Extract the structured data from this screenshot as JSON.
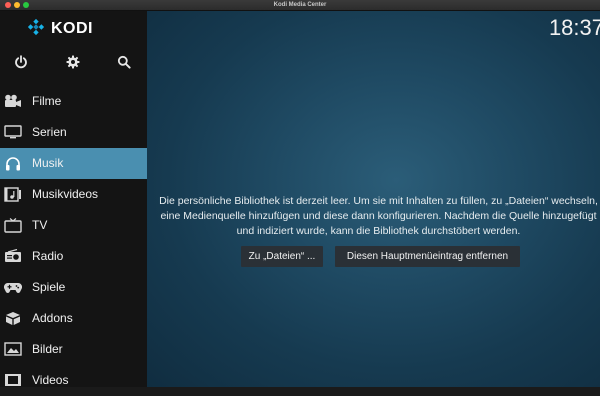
{
  "window": {
    "title": "Kodi Media Center"
  },
  "brand": {
    "name": "KODI",
    "color": "#17b2e7"
  },
  "system": {
    "icons": [
      "power-icon",
      "gear-icon",
      "search-icon"
    ]
  },
  "sidebar": {
    "active_color": "#4a8fb0",
    "items": [
      {
        "label": "Filme",
        "icon": "movie-camera-icon",
        "active": false
      },
      {
        "label": "Serien",
        "icon": "tv-screen-icon",
        "active": false
      },
      {
        "label": "Musik",
        "icon": "headphones-icon",
        "active": true
      },
      {
        "label": "Musikvideos",
        "icon": "music-video-icon",
        "active": false
      },
      {
        "label": "TV",
        "icon": "television-icon",
        "active": false
      },
      {
        "label": "Radio",
        "icon": "radio-icon",
        "active": false
      },
      {
        "label": "Spiele",
        "icon": "gamepad-icon",
        "active": false
      },
      {
        "label": "Addons",
        "icon": "box-icon",
        "active": false
      },
      {
        "label": "Bilder",
        "icon": "picture-icon",
        "active": false
      },
      {
        "label": "Videos",
        "icon": "film-icon",
        "active": false
      }
    ]
  },
  "main": {
    "clock": "18:37",
    "message": "Die persönliche Bibliothek ist derzeit leer. Um sie mit Inhalten zu füllen, zu „Dateien“ wechseln, eine Medienquelle hinzufügen und diese dann konfigurieren. Nachdem die Quelle hinzugefügt und indiziert wurde, kann die Bibliothek durchstöbert werden.",
    "buttons": {
      "files": "Zu „Dateien“ ...",
      "remove": "Diesen Hauptmenüeintrag entfernen"
    }
  }
}
